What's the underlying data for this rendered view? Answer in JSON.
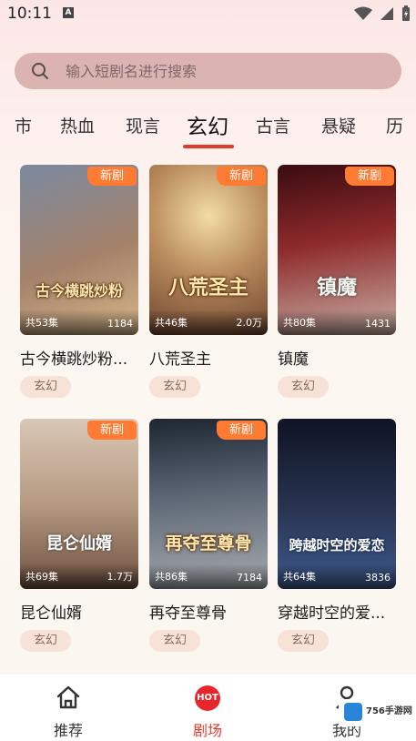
{
  "status_bar": {
    "time": "10:11",
    "notif_glyph": "A"
  },
  "search": {
    "placeholder": "输入短剧名进行搜索"
  },
  "tabs": [
    {
      "label": "市"
    },
    {
      "label": "热血"
    },
    {
      "label": "现言"
    },
    {
      "label": "玄幻",
      "active": true
    },
    {
      "label": "古言"
    },
    {
      "label": "悬疑"
    },
    {
      "label": "历"
    }
  ],
  "dramas": [
    {
      "title": "古今横跳炒粉...",
      "poster_text": "古今横跳炒粉",
      "badge": "新剧",
      "episodes": "共53集",
      "views": "1184",
      "genre": "玄幻",
      "colors": [
        "#6b7d95",
        "#c9a57d"
      ]
    },
    {
      "title": "八荒圣主",
      "poster_text": "八荒圣主",
      "badge": "新剧",
      "episodes": "共46集",
      "views": "2.0万",
      "genre": "玄幻",
      "colors": [
        "#8a5a3c",
        "#e7c58e"
      ]
    },
    {
      "title": "镇魔",
      "poster_text": "镇魔",
      "badge": "新剧",
      "episodes": "共80集",
      "views": "1431",
      "genre": "玄幻",
      "colors": [
        "#5a1818",
        "#b34443"
      ]
    },
    {
      "title": "昆仑仙婿",
      "poster_text": "昆仑仙婿",
      "badge": "新剧",
      "episodes": "共69集",
      "views": "1.7万",
      "genre": "玄幻",
      "colors": [
        "#c9b6a5",
        "#7c5e4f"
      ]
    },
    {
      "title": "再夺至尊骨",
      "poster_text": "再夺至尊骨",
      "badge": "新剧",
      "episodes": "共86集",
      "views": "7184",
      "genre": "玄幻",
      "colors": [
        "#2c3646",
        "#9aa3ad"
      ]
    },
    {
      "title": "穿越时空的爱...",
      "poster_text": "跨越时空的爱恋",
      "badge": "",
      "episodes": "共64集",
      "views": "3836",
      "genre": "玄幻",
      "colors": [
        "#151a2e",
        "#3d4f7d"
      ]
    }
  ],
  "bottom_nav": [
    {
      "label": "推荐",
      "icon": "home-icon"
    },
    {
      "label": "剧场",
      "icon": "hot-icon",
      "badge": "HOT",
      "active": true
    },
    {
      "label": "我的",
      "icon": "profile-icon"
    }
  ],
  "watermark": {
    "text": "756手游网"
  }
}
